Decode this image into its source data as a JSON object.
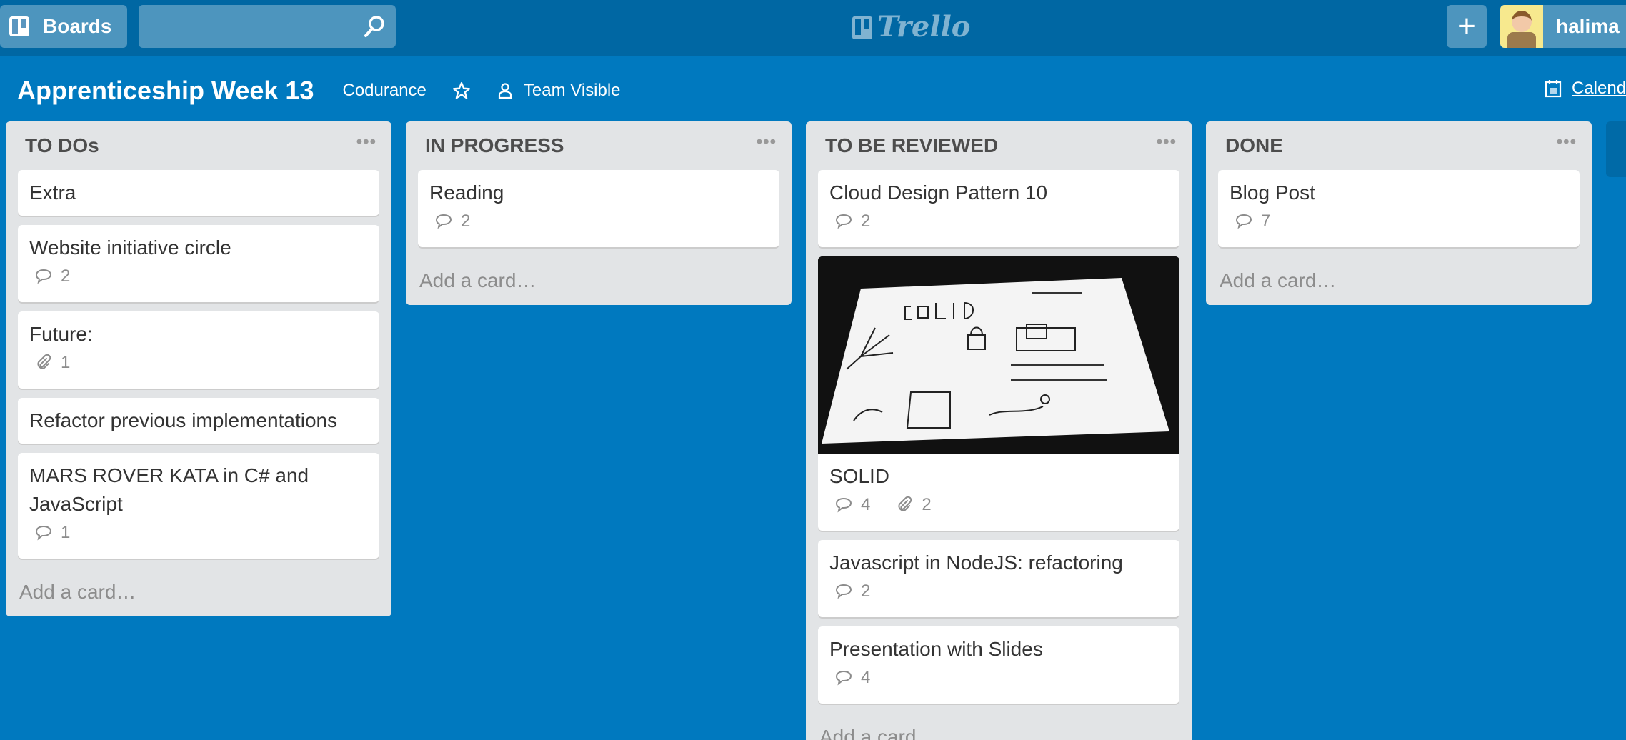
{
  "topbar": {
    "boards_label": "Boards",
    "search_placeholder": "",
    "logo": "Trello",
    "user_name": "halima l",
    "icons": [
      "boards-icon",
      "search-icon",
      "plus-icon",
      "avatar"
    ]
  },
  "board": {
    "title": "Apprenticeship Week 13",
    "team": "Codurance",
    "visibility": "Team Visible",
    "calendar": "Calendar"
  },
  "colors": {
    "topbar": "#0067a3",
    "board_bg": "#0079bf",
    "list_bg": "#e2e4e6"
  },
  "add_card_label": "Add a card…",
  "lists": [
    {
      "name": "TO DOs",
      "cards": [
        {
          "title": "Extra"
        },
        {
          "title": "Website initiative circle",
          "comments": "2"
        },
        {
          "title": "Future:",
          "attachments": "1"
        },
        {
          "title": "Refactor previous implementations"
        },
        {
          "title": "MARS ROVER KATA in C# and JavaScript",
          "comments": "1"
        }
      ]
    },
    {
      "name": "IN PROGRESS",
      "cards": [
        {
          "title": "Reading",
          "comments": "2"
        }
      ]
    },
    {
      "name": "TO BE REVIEWED",
      "cards": [
        {
          "title": "Cloud Design Pattern 10",
          "comments": "2"
        },
        {
          "title": "SOLID",
          "comments": "4",
          "attachments": "2",
          "cover": true
        },
        {
          "title": "Javascript in NodeJS: refactoring",
          "comments": "2"
        },
        {
          "title": "Presentation with Slides",
          "comments": "4"
        }
      ]
    },
    {
      "name": "DONE",
      "cards": [
        {
          "title": "Blog Post",
          "comments": "7"
        }
      ]
    }
  ]
}
